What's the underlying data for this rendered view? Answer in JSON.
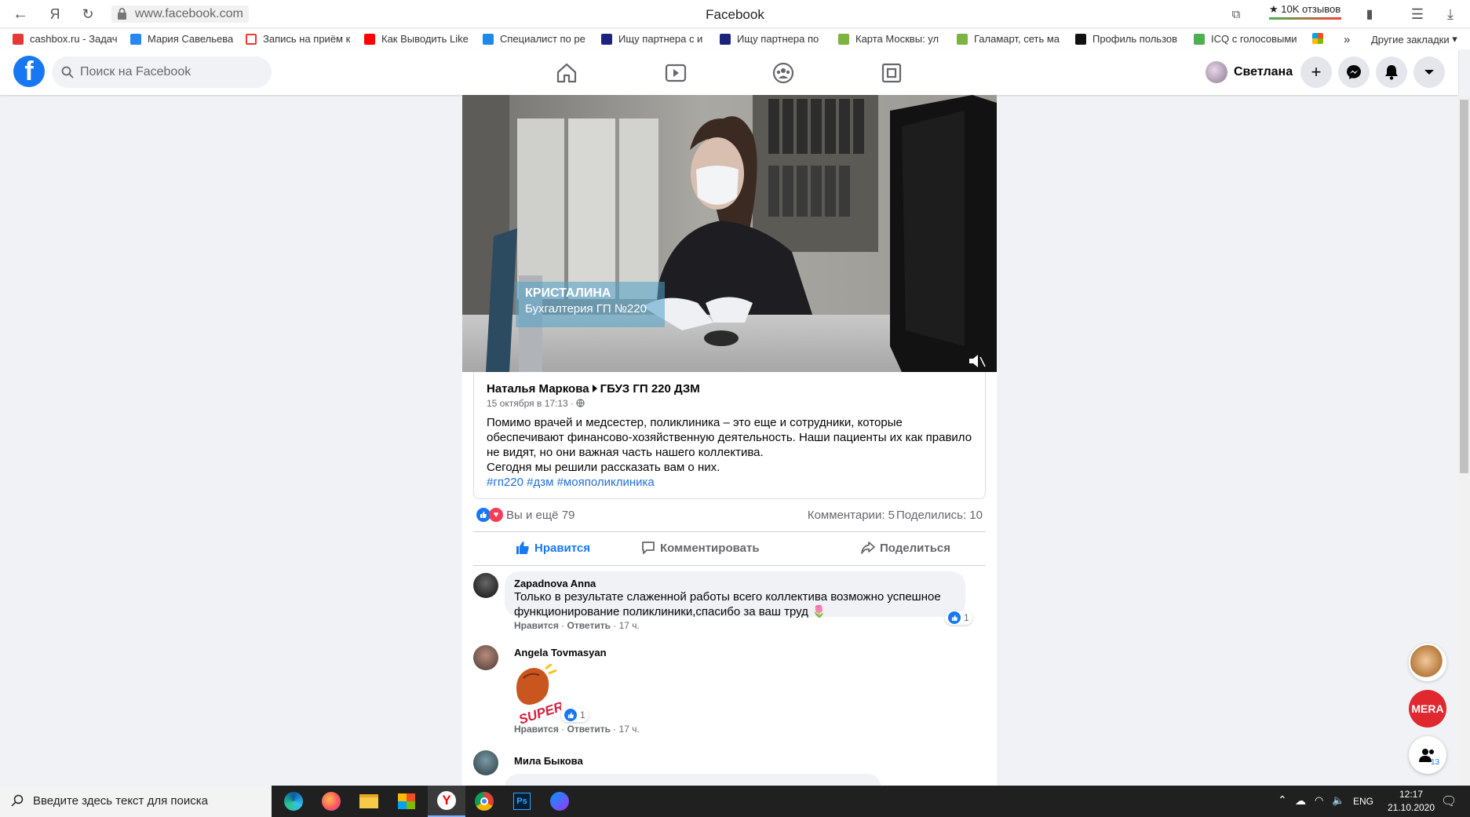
{
  "browser": {
    "url": "www.facebook.com",
    "window_title": "Facebook",
    "reviews_badge": "★ 10K отзывов",
    "bookmarks": [
      {
        "label": "cashbox.ru - Задач",
        "color": "#e53935"
      },
      {
        "label": "Мария Савельева",
        "color": "#2787f5"
      },
      {
        "label": "Запись на приём к",
        "color": "#e53935"
      },
      {
        "label": "Как Выводить Like",
        "color": "#ff0000"
      },
      {
        "label": "Специалист по ре",
        "color": "#1e88e5"
      },
      {
        "label": "Ищу партнера с и",
        "color": "#1a237e"
      },
      {
        "label": "Ищу партнера по",
        "color": "#1a237e"
      },
      {
        "label": "Карта Москвы: ул",
        "color": "#7cb342"
      },
      {
        "label": "Галамарт, сеть ма",
        "color": "#7cb342"
      },
      {
        "label": "Профиль пользов",
        "color": "#111111"
      },
      {
        "label": "ICQ с голосовыми",
        "color": "#4caf50"
      }
    ],
    "other_bookmarks": "Другие закладки"
  },
  "facebook": {
    "search_placeholder": "Поиск на Facebook",
    "profile_name": "Светлана",
    "accent": "#1877f2"
  },
  "post": {
    "video_caption_name": "КРИСТАЛИНА",
    "video_caption_sub": "Бухгалтерия ГП №220",
    "author": "Наталья Маркова",
    "target": "ГБУЗ ГП 220 ДЗМ",
    "date": "15 октября в 17:13 ·",
    "text_lines": [
      "Помимо врачей и медсестер, поликлиника – это еще и сотрудники, которые",
      "обеспечивают финансово-хозяйственную деятельность. Наши пациенты их как правило",
      "не видят, но они важная часть нашего коллектива.",
      "Сегодня мы решили рассказать вам о них."
    ],
    "hashtags": "#гп220 #дзм #мояполиклиника",
    "reactions_text": "Вы и ещё 79",
    "comments_count": "Комментарии: 5",
    "shares_count": "Поделились: 10",
    "actions": {
      "like": "Нравится",
      "comment": "Комментировать",
      "share": "Поделиться"
    }
  },
  "comments": [
    {
      "name": "Zapadnova Anna",
      "text_lines": [
        "Только в результате слаженной работы всего коллектива возможно успешное",
        "функционирование поликлиники,спасибо за ваш труд 🌷"
      ],
      "likes": "1",
      "like_action": "Нравится",
      "reply_action": "Ответить",
      "time": "17 ч."
    },
    {
      "name": "Angela Tovmasyan",
      "sticker_text": "SUPER!",
      "likes": "1",
      "like_action": "Нравится",
      "reply_action": "Ответить",
      "time": "17 ч."
    },
    {
      "name": "Мила Быкова"
    }
  ],
  "floating": {
    "mera_label": "MERA",
    "people_count": "13"
  },
  "taskbar": {
    "search_placeholder": "Введите здесь текст для поиска",
    "language": "ENG",
    "time": "12:17",
    "date": "21.10.2020"
  }
}
